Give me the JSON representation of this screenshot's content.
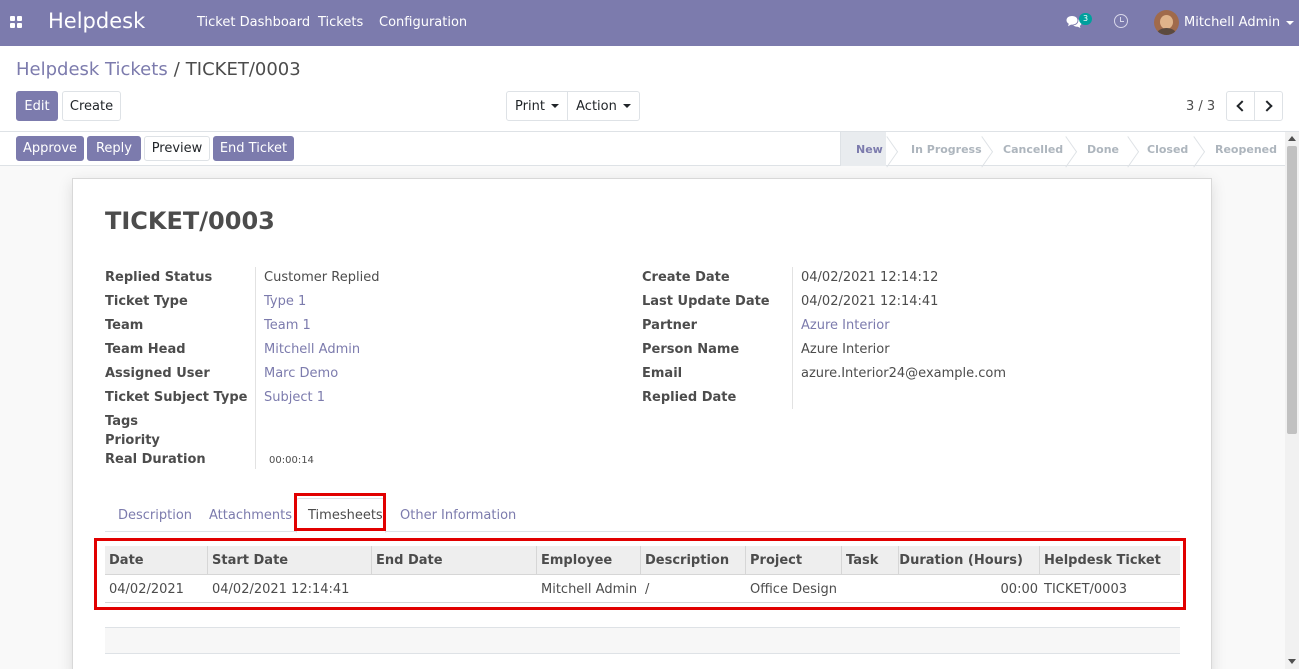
{
  "navbar": {
    "brand": "Helpdesk",
    "menu": [
      "Ticket Dashboard",
      "Tickets",
      "Configuration"
    ],
    "chat_badge": "3",
    "user_name": "Mitchell Admin"
  },
  "breadcrumb": {
    "parent": "Helpdesk Tickets",
    "separator": "/",
    "current": "TICKET/0003"
  },
  "control": {
    "edit_label": "Edit",
    "create_label": "Create",
    "print_label": "Print",
    "action_label": "Action",
    "pager_value": "3 / 3"
  },
  "statusbar": {
    "buttons": [
      "Approve",
      "Reply",
      "Preview",
      "End Ticket"
    ],
    "stages": [
      "New",
      "In Progress",
      "Cancelled",
      "Done",
      "Closed",
      "Reopened"
    ],
    "active_stage": "New"
  },
  "ticket": {
    "name": "TICKET/0003",
    "left_fields": [
      {
        "label": "Replied Status",
        "value": "Customer Replied"
      },
      {
        "label": "Ticket Type",
        "value": "Type 1"
      },
      {
        "label": "Team",
        "value": "Team 1"
      },
      {
        "label": "Team Head",
        "value": "Mitchell Admin"
      },
      {
        "label": "Assigned User",
        "value": "Marc Demo"
      },
      {
        "label": "Ticket Subject Type",
        "value": "Subject 1"
      },
      {
        "label": "Tags",
        "value": ""
      },
      {
        "label": "Priority",
        "value": ""
      },
      {
        "label": "Real Duration",
        "value": "00:00:14"
      }
    ],
    "right_fields": [
      {
        "label": "Create Date",
        "value": "04/02/2021 12:14:12"
      },
      {
        "label": "Last Update Date",
        "value": "04/02/2021 12:14:41"
      },
      {
        "label": "Partner",
        "value": "Azure Interior"
      },
      {
        "label": "Person Name",
        "value": "Azure Interior"
      },
      {
        "label": "Email",
        "value": "azure.Interior24@example.com"
      },
      {
        "label": "Replied Date",
        "value": ""
      }
    ]
  },
  "tabs": [
    "Description",
    "Attachments",
    "Timesheets",
    "Other Information"
  ],
  "active_tab": "Timesheets",
  "timesheet": {
    "columns": [
      "Date",
      "Start Date",
      "End Date",
      "Employee",
      "Description",
      "Project",
      "Task",
      "Duration (Hours)",
      "Helpdesk Ticket"
    ],
    "rows": [
      [
        "04/02/2021",
        "04/02/2021 12:14:41",
        "",
        "Mitchell Admin",
        "/",
        "Office Design",
        "",
        "00:00",
        "TICKET/0003"
      ]
    ]
  },
  "colors": {
    "brand": "#7c7bad",
    "highlight": "#e10000"
  }
}
